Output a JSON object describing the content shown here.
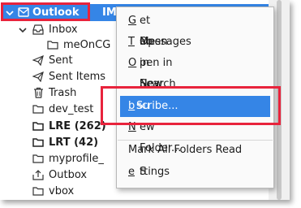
{
  "colors": {
    "selection": "#3585e6",
    "highlight": "#e8233c"
  },
  "folders": [
    {
      "label": "Outlook",
      "suffix": "IMAP)",
      "icon": "mail-account-icon",
      "selected": true
    },
    {
      "label": "Inbox",
      "icon": "inbox-icon"
    },
    {
      "label": "meOnCG",
      "icon": "folder-icon"
    },
    {
      "label": "Sent",
      "icon": "sent-icon"
    },
    {
      "label": "Sent Items",
      "icon": "sent-icon"
    },
    {
      "label": "Trash",
      "icon": "trash-icon"
    },
    {
      "label": "dev_test",
      "icon": "folder-icon"
    },
    {
      "label": "LRE (262)",
      "icon": "folder-icon",
      "bold": true
    },
    {
      "label": "LRT (42)",
      "icon": "folder-icon",
      "bold": true
    },
    {
      "label": "myprofile_",
      "icon": "folder-icon"
    },
    {
      "label": "Outbox",
      "icon": "outbox-icon"
    },
    {
      "label": "vbox",
      "icon": "folder-icon"
    }
  ],
  "menu": {
    "get_messages": {
      "pre": "",
      "acc": "G",
      "post": "et Messages"
    },
    "open_new_tab": {
      "pre": "Open in New ",
      "acc": "T",
      "post": "ab"
    },
    "open_new_window": {
      "pre": "",
      "acc": "O",
      "post": "pen in New Window"
    },
    "search_messages": {
      "pre": "Search Messages",
      "acc": "",
      "post": "..."
    },
    "subscribe": {
      "pre": "Su",
      "acc": "b",
      "post": "scribe..."
    },
    "new_folder": {
      "pre": "",
      "acc": "N",
      "post": "ew Folder..."
    },
    "mark_all_read": {
      "pre": "Mark All Folders Read",
      "acc": "",
      "post": ""
    },
    "settings": {
      "pre": "S",
      "acc": "e",
      "post": "ttings"
    }
  }
}
